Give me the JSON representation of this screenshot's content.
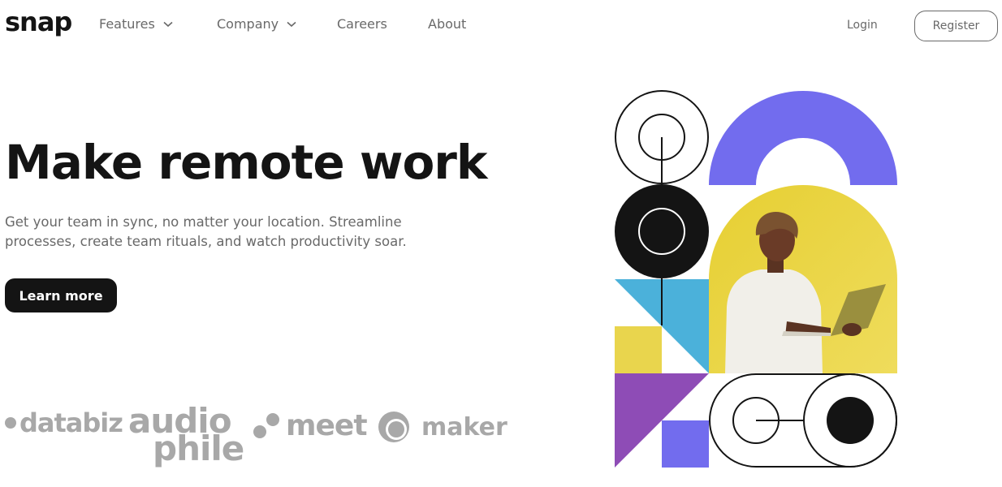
{
  "header": {
    "logo": "snap",
    "nav": [
      {
        "label": "Features",
        "has_dropdown": true
      },
      {
        "label": "Company",
        "has_dropdown": true
      },
      {
        "label": "Careers",
        "has_dropdown": false
      },
      {
        "label": "About",
        "has_dropdown": false
      }
    ],
    "login_label": "Login",
    "register_label": "Register"
  },
  "hero": {
    "title": "Make remote work",
    "description": "Get your team in sync, no matter your location. Streamline processes, create team rituals, and watch productivity soar.",
    "cta_label": "Learn more"
  },
  "clients": {
    "databiz": "databiz",
    "audiophile_line1": "audio",
    "audiophile_line2": "phile",
    "meet": "meet",
    "maker": "maker"
  },
  "colors": {
    "ink": "#141414",
    "muted": "#696969",
    "logo_gray": "#a8a8a8",
    "violet": "#726cee",
    "yellow": "#e9d54d",
    "sky": "#4bb1da",
    "purple": "#8e4cb6"
  }
}
